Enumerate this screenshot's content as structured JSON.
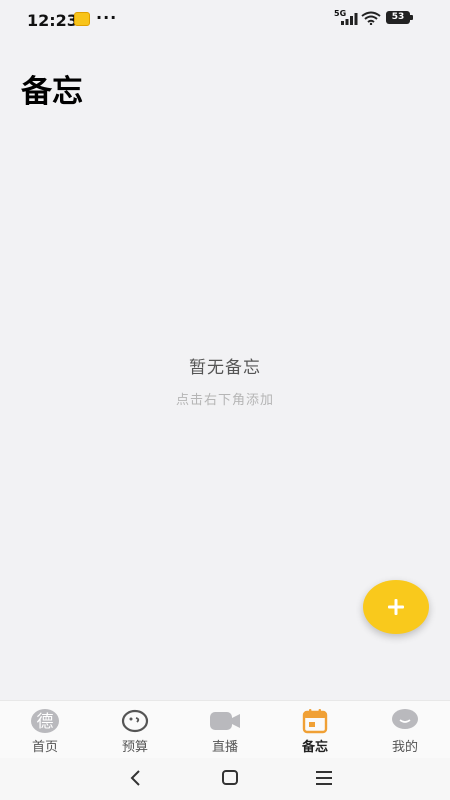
{
  "status_bar": {
    "time": "12:23",
    "overflow": "···",
    "network": "5G",
    "battery": "53"
  },
  "page": {
    "title": "备忘"
  },
  "empty_state": {
    "title": "暂无备忘",
    "hint": "点击右下角添加"
  },
  "fab": {
    "icon": "plus-icon",
    "color": "#f9c91c"
  },
  "bottom_nav": {
    "items": [
      {
        "label": "首页",
        "icon": "home-icon",
        "glyph": "德",
        "active": false
      },
      {
        "label": "预算",
        "icon": "budget-icon",
        "active": false
      },
      {
        "label": "直播",
        "icon": "live-camera-icon",
        "active": false
      },
      {
        "label": "备忘",
        "icon": "calendar-icon",
        "active": true
      },
      {
        "label": "我的",
        "icon": "profile-icon",
        "active": false
      }
    ],
    "active_color": "#f0a035"
  },
  "system_nav": {
    "buttons": [
      "back-icon",
      "home-square-icon",
      "menu-icon"
    ]
  }
}
